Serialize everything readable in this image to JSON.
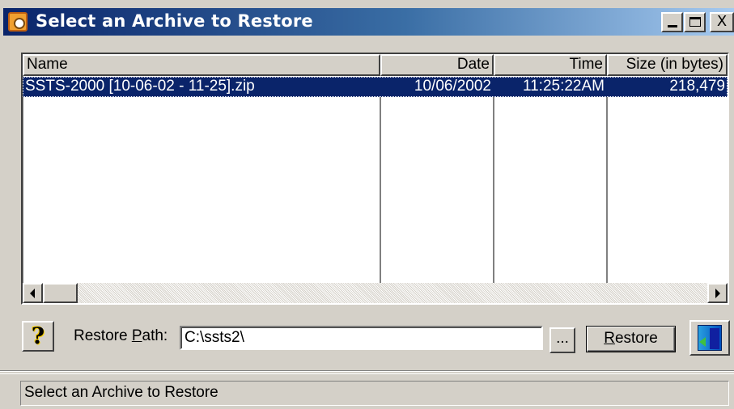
{
  "window": {
    "title": "Select an Archive to Restore"
  },
  "title_buttons": {
    "minimize_icon": "minimize-icon",
    "maximize_icon": "maximize-icon",
    "close_label": "X"
  },
  "list": {
    "columns": [
      "Name",
      "Date",
      "Time",
      "Size (in bytes)"
    ],
    "rows": [
      {
        "name": "SSTS-2000 [10-06-02 - 11-25].zip",
        "date": "10/06/2002",
        "time": "11:25:22AM",
        "size": "218,479",
        "selected": true
      }
    ]
  },
  "controls": {
    "help_label": "?",
    "restore_path_label_pre": "Restore ",
    "restore_path_label_hotkey": "P",
    "restore_path_label_post": "ath:",
    "restore_path_value": "C:\\ssts2\\",
    "browse_label": "...",
    "restore_button_hotkey": "R",
    "restore_button_rest": "estore",
    "exit_icon": "exit-door-icon"
  },
  "statusbar": {
    "text": "Select an Archive to Restore"
  },
  "colors": {
    "titlebar_start": "#0a246a",
    "titlebar_end": "#a6caf0",
    "selection": "#0a246a",
    "face": "#d4d0c8"
  }
}
